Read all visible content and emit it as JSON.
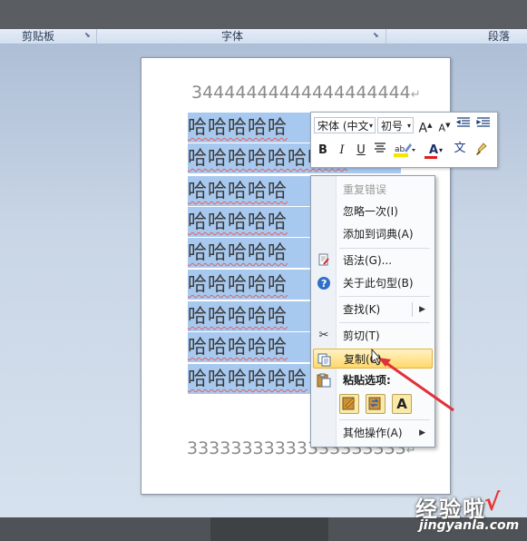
{
  "ribbon": {
    "groups": [
      "剪贴板",
      "字体",
      "段落"
    ]
  },
  "document": {
    "top_line": "34444444444444444444",
    "bottom_line": "33333333333333333333",
    "paragraph_mark": "↵",
    "selected_rows": [
      "哈哈哈哈哈",
      "哈哈哈哈哈哈哈哈",
      "哈哈哈哈哈",
      "哈哈哈哈哈",
      "哈哈哈哈哈",
      "哈哈哈哈哈",
      "哈哈哈哈哈",
      "哈哈哈哈哈",
      "哈哈哈哈哈哈"
    ]
  },
  "mini_toolbar": {
    "font_name": "宋体 (中文",
    "font_size": "初号",
    "grow_font": "A",
    "shrink_font": "A",
    "bold": "B",
    "italic": "I",
    "underline": "U",
    "font_color": "A",
    "phonetic_guide": "文"
  },
  "context_menu": {
    "items": [
      {
        "label": "重复错误",
        "disabled": true
      },
      {
        "label": "忽略一次(I)"
      },
      {
        "label": "添加到词典(A)"
      },
      {
        "label": "语法(G)..."
      },
      {
        "label": "关于此句型(B)"
      },
      {
        "label": "查找(K)"
      },
      {
        "label": "剪切(T)"
      },
      {
        "label": "复制(C)",
        "highlighted": true
      },
      {
        "label": "粘贴选项:"
      },
      {
        "label": "其他操作(A)"
      }
    ]
  },
  "watermark": {
    "text": "经验啦",
    "url": "jingyanla.com",
    "check": "√"
  },
  "colors": {
    "selection": "#a8c9ef",
    "menu_highlight": "#ffd86a",
    "annotation_arrow": "#e0303a"
  }
}
